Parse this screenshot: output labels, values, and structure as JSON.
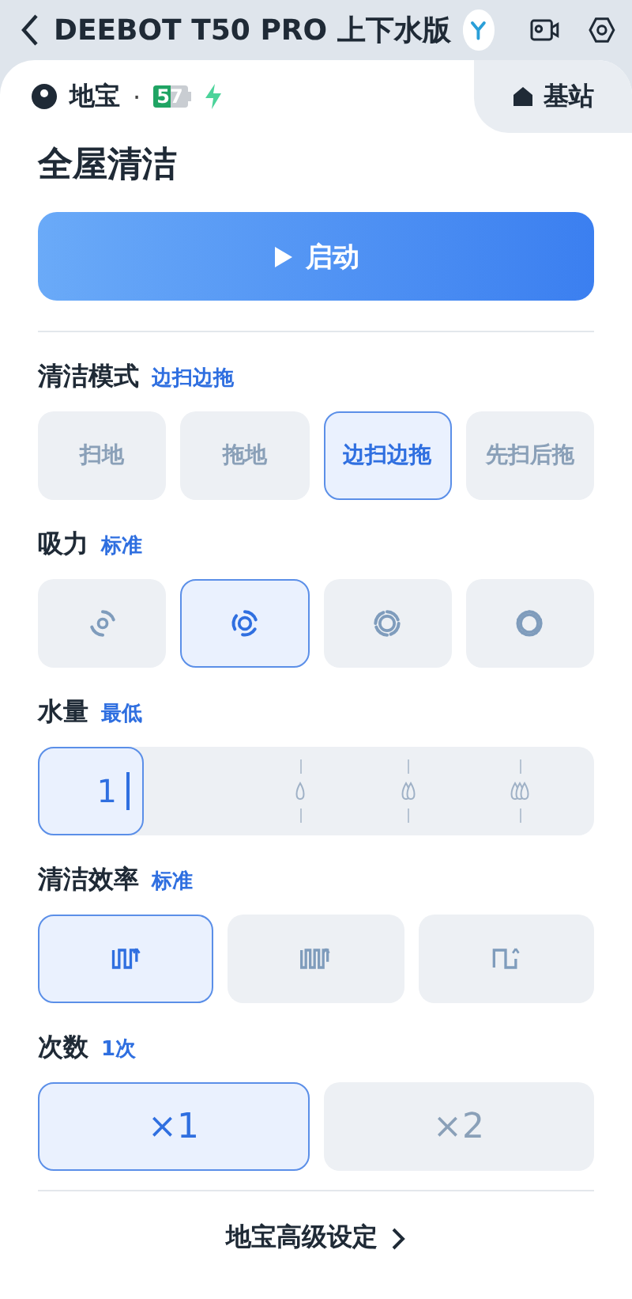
{
  "top_bar": {
    "title": "DEEBOT T50 PRO 上下水版"
  },
  "status": {
    "name": "地宝",
    "separator": "·",
    "battery": "57",
    "charging": true,
    "station_tab": "基站"
  },
  "page_title": "全屋清洁",
  "start_button": {
    "label": "启动"
  },
  "sections": [
    {
      "kind": "text",
      "label": "清洁模式",
      "value": "边扫边拖",
      "options": [
        {
          "label": "扫地",
          "selected": false
        },
        {
          "label": "拖地",
          "selected": false
        },
        {
          "label": "边扫边拖",
          "selected": true
        },
        {
          "label": "先扫后拖",
          "selected": false
        }
      ]
    },
    {
      "kind": "suction",
      "label": "吸力",
      "value": "标准",
      "options": [
        {
          "selected": false
        },
        {
          "selected": true
        },
        {
          "selected": false
        },
        {
          "selected": false
        }
      ]
    },
    {
      "kind": "slider",
      "label": "水量",
      "value": "最低",
      "reading": "1"
    },
    {
      "kind": "efficiency",
      "label": "清洁效率",
      "value": "标准",
      "options": [
        {
          "selected": true
        },
        {
          "selected": false
        },
        {
          "selected": false
        }
      ]
    },
    {
      "kind": "times",
      "label": "次数",
      "value": "1次",
      "options": [
        {
          "label": "×1",
          "selected": true
        },
        {
          "label": "×2",
          "selected": false
        }
      ]
    }
  ],
  "footer_link": "地宝高级设定"
}
